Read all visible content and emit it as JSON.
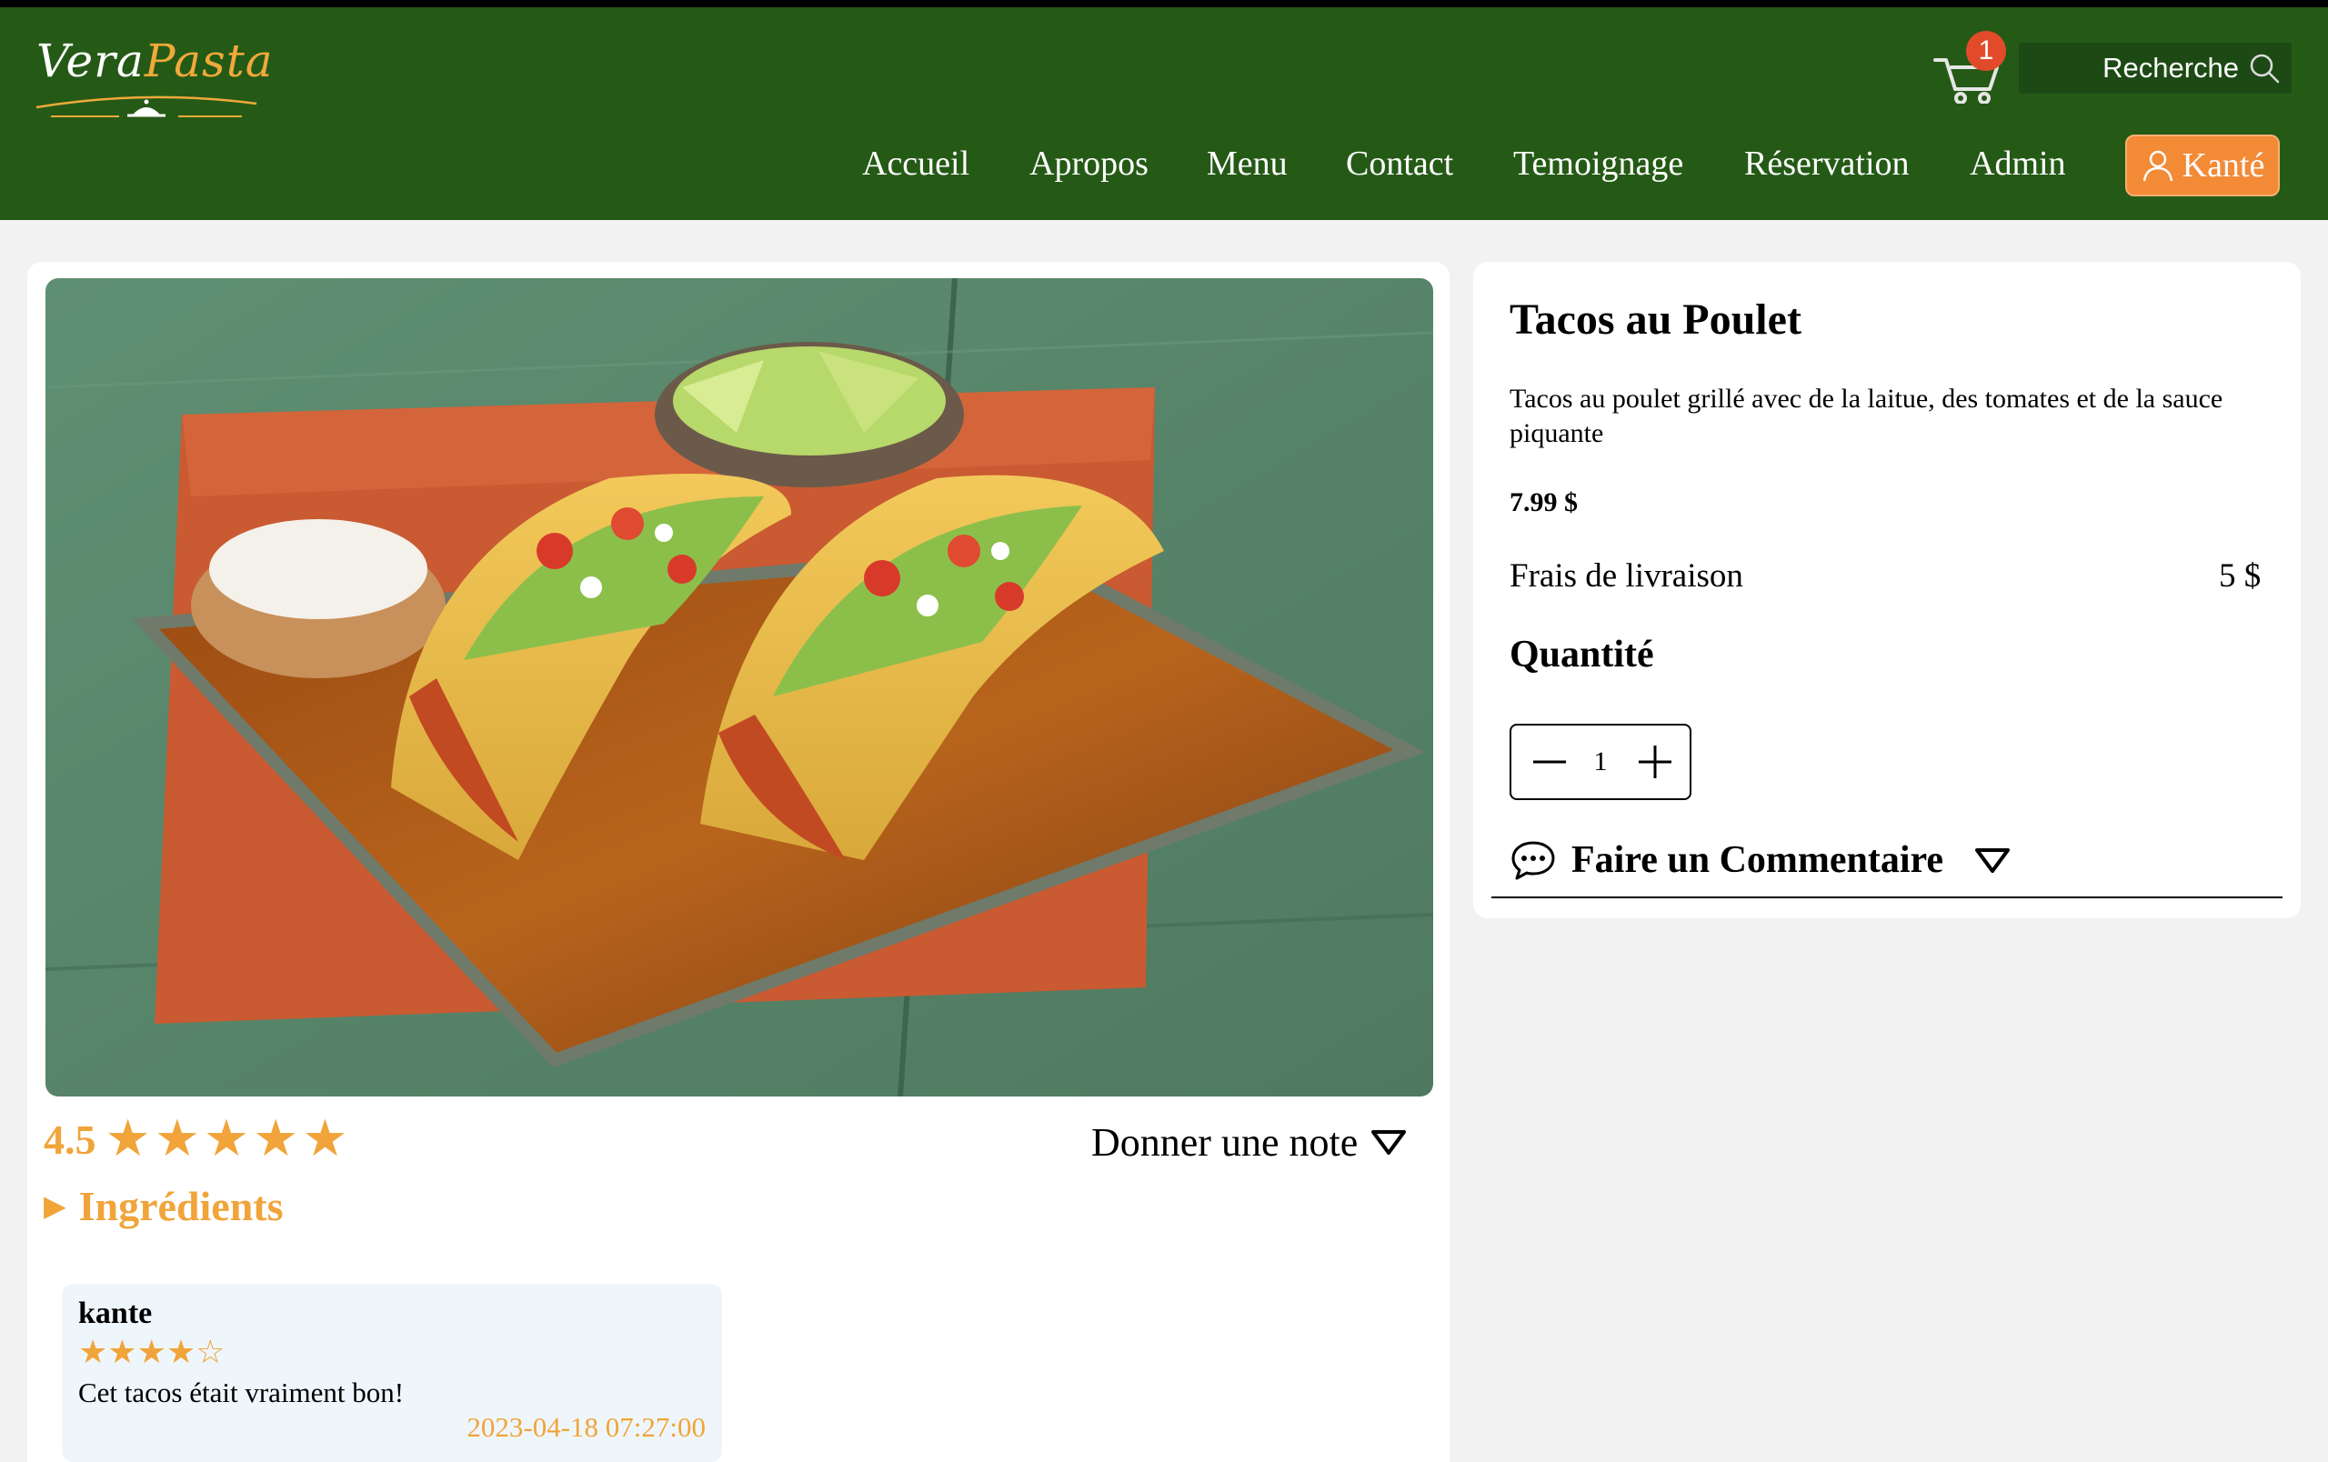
{
  "header": {
    "logo": {
      "part1": "Vera",
      "part2": "Pasta"
    },
    "cart": {
      "count": "1"
    },
    "search": {
      "placeholder": "Recherche"
    },
    "nav": [
      {
        "label": "Accueil"
      },
      {
        "label": "Apropos"
      },
      {
        "label": "Menu"
      },
      {
        "label": "Contact"
      },
      {
        "label": "Temoignage"
      },
      {
        "label": "Réservation"
      },
      {
        "label": "Admin"
      }
    ],
    "user": {
      "label": "Kanté"
    },
    "colors": {
      "bar": "#255a16",
      "accent": "#f28a36",
      "badge": "#e24b2a"
    }
  },
  "product": {
    "image_icon": "tacos-photo",
    "rating": {
      "value": "4.5",
      "stars_filled": 5,
      "star_char": "★"
    },
    "give_rating_label": "Donner une note",
    "ingredients_label": "Ingrédients",
    "title": "Tacos au Poulet",
    "description": "Tacos au poulet grillé avec de la laitue, des tomates et de la sauce piquante",
    "price": "7.99 $",
    "delivery": {
      "label": "Frais de livraison",
      "value": "5 $"
    },
    "quantity": {
      "label": "Quantité",
      "value": "1"
    },
    "comment_label": "Faire un Commentaire"
  },
  "reviews": [
    {
      "author": "kante",
      "stars": "★★★★☆",
      "rating": 4,
      "text": "Cet tacos était vraiment bon!",
      "date": "2023-04-18 07:27:00"
    }
  ],
  "colors": {
    "accent_text": "#f0a43a"
  }
}
